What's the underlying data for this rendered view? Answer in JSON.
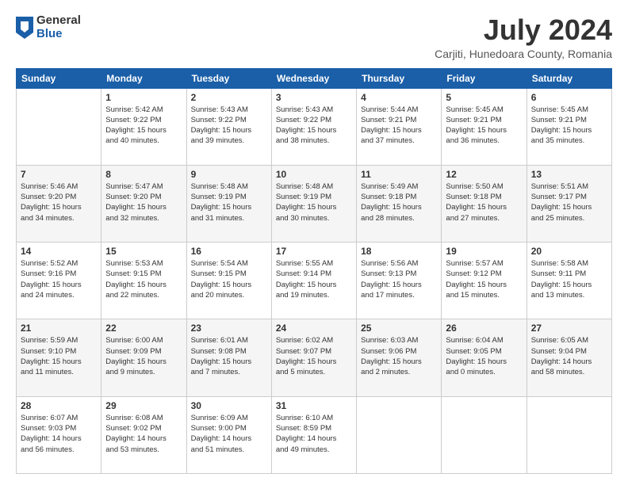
{
  "logo": {
    "general": "General",
    "blue": "Blue"
  },
  "title": "July 2024",
  "location": "Carjiti, Hunedoara County, Romania",
  "days": [
    "Sunday",
    "Monday",
    "Tuesday",
    "Wednesday",
    "Thursday",
    "Friday",
    "Saturday"
  ],
  "weeks": [
    [
      {
        "date": "",
        "info": ""
      },
      {
        "date": "1",
        "info": "Sunrise: 5:42 AM\nSunset: 9:22 PM\nDaylight: 15 hours\nand 40 minutes."
      },
      {
        "date": "2",
        "info": "Sunrise: 5:43 AM\nSunset: 9:22 PM\nDaylight: 15 hours\nand 39 minutes."
      },
      {
        "date": "3",
        "info": "Sunrise: 5:43 AM\nSunset: 9:22 PM\nDaylight: 15 hours\nand 38 minutes."
      },
      {
        "date": "4",
        "info": "Sunrise: 5:44 AM\nSunset: 9:21 PM\nDaylight: 15 hours\nand 37 minutes."
      },
      {
        "date": "5",
        "info": "Sunrise: 5:45 AM\nSunset: 9:21 PM\nDaylight: 15 hours\nand 36 minutes."
      },
      {
        "date": "6",
        "info": "Sunrise: 5:45 AM\nSunset: 9:21 PM\nDaylight: 15 hours\nand 35 minutes."
      }
    ],
    [
      {
        "date": "7",
        "info": "Sunrise: 5:46 AM\nSunset: 9:20 PM\nDaylight: 15 hours\nand 34 minutes."
      },
      {
        "date": "8",
        "info": "Sunrise: 5:47 AM\nSunset: 9:20 PM\nDaylight: 15 hours\nand 32 minutes."
      },
      {
        "date": "9",
        "info": "Sunrise: 5:48 AM\nSunset: 9:19 PM\nDaylight: 15 hours\nand 31 minutes."
      },
      {
        "date": "10",
        "info": "Sunrise: 5:48 AM\nSunset: 9:19 PM\nDaylight: 15 hours\nand 30 minutes."
      },
      {
        "date": "11",
        "info": "Sunrise: 5:49 AM\nSunset: 9:18 PM\nDaylight: 15 hours\nand 28 minutes."
      },
      {
        "date": "12",
        "info": "Sunrise: 5:50 AM\nSunset: 9:18 PM\nDaylight: 15 hours\nand 27 minutes."
      },
      {
        "date": "13",
        "info": "Sunrise: 5:51 AM\nSunset: 9:17 PM\nDaylight: 15 hours\nand 25 minutes."
      }
    ],
    [
      {
        "date": "14",
        "info": "Sunrise: 5:52 AM\nSunset: 9:16 PM\nDaylight: 15 hours\nand 24 minutes."
      },
      {
        "date": "15",
        "info": "Sunrise: 5:53 AM\nSunset: 9:15 PM\nDaylight: 15 hours\nand 22 minutes."
      },
      {
        "date": "16",
        "info": "Sunrise: 5:54 AM\nSunset: 9:15 PM\nDaylight: 15 hours\nand 20 minutes."
      },
      {
        "date": "17",
        "info": "Sunrise: 5:55 AM\nSunset: 9:14 PM\nDaylight: 15 hours\nand 19 minutes."
      },
      {
        "date": "18",
        "info": "Sunrise: 5:56 AM\nSunset: 9:13 PM\nDaylight: 15 hours\nand 17 minutes."
      },
      {
        "date": "19",
        "info": "Sunrise: 5:57 AM\nSunset: 9:12 PM\nDaylight: 15 hours\nand 15 minutes."
      },
      {
        "date": "20",
        "info": "Sunrise: 5:58 AM\nSunset: 9:11 PM\nDaylight: 15 hours\nand 13 minutes."
      }
    ],
    [
      {
        "date": "21",
        "info": "Sunrise: 5:59 AM\nSunset: 9:10 PM\nDaylight: 15 hours\nand 11 minutes."
      },
      {
        "date": "22",
        "info": "Sunrise: 6:00 AM\nSunset: 9:09 PM\nDaylight: 15 hours\nand 9 minutes."
      },
      {
        "date": "23",
        "info": "Sunrise: 6:01 AM\nSunset: 9:08 PM\nDaylight: 15 hours\nand 7 minutes."
      },
      {
        "date": "24",
        "info": "Sunrise: 6:02 AM\nSunset: 9:07 PM\nDaylight: 15 hours\nand 5 minutes."
      },
      {
        "date": "25",
        "info": "Sunrise: 6:03 AM\nSunset: 9:06 PM\nDaylight: 15 hours\nand 2 minutes."
      },
      {
        "date": "26",
        "info": "Sunrise: 6:04 AM\nSunset: 9:05 PM\nDaylight: 15 hours\nand 0 minutes."
      },
      {
        "date": "27",
        "info": "Sunrise: 6:05 AM\nSunset: 9:04 PM\nDaylight: 14 hours\nand 58 minutes."
      }
    ],
    [
      {
        "date": "28",
        "info": "Sunrise: 6:07 AM\nSunset: 9:03 PM\nDaylight: 14 hours\nand 56 minutes."
      },
      {
        "date": "29",
        "info": "Sunrise: 6:08 AM\nSunset: 9:02 PM\nDaylight: 14 hours\nand 53 minutes."
      },
      {
        "date": "30",
        "info": "Sunrise: 6:09 AM\nSunset: 9:00 PM\nDaylight: 14 hours\nand 51 minutes."
      },
      {
        "date": "31",
        "info": "Sunrise: 6:10 AM\nSunset: 8:59 PM\nDaylight: 14 hours\nand 49 minutes."
      },
      {
        "date": "",
        "info": ""
      },
      {
        "date": "",
        "info": ""
      },
      {
        "date": "",
        "info": ""
      }
    ]
  ]
}
